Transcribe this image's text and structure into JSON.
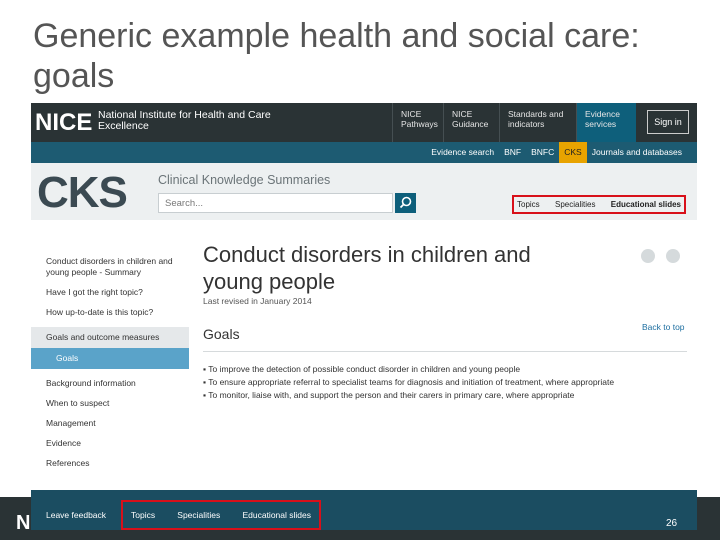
{
  "slide": {
    "title": "Generic example health and social care: goals",
    "page_number": "26",
    "footer_logo": "NICE"
  },
  "topbar": {
    "logo": "NICE",
    "logo_sub": "National Institute for Health and Care Excellence",
    "nav": [
      "NICE Pathways",
      "NICE Guidance",
      "Standards and indicators",
      "Evidence services"
    ],
    "signin": "Sign in"
  },
  "subnav": [
    "Evidence search",
    "BNF",
    "BNFC",
    "CKS",
    "Journals and databases"
  ],
  "cks": {
    "logo": "CKS",
    "title": "Clinical Knowledge Summaries",
    "search_placeholder": "Search...",
    "tabs": [
      "Topics",
      "Specialities",
      "Educational slides"
    ]
  },
  "leftnav": {
    "items": [
      "Conduct disorders in children and young people - Summary",
      "Have I got the right topic?",
      "How up-to-date is this topic?",
      "Goals and outcome measures",
      "Goals",
      "Background information",
      "When to suspect",
      "Management",
      "Evidence",
      "References"
    ]
  },
  "main": {
    "heading": "Conduct disorders in children and young people",
    "revised": "Last revised in January 2014",
    "section": "Goals",
    "back_to_top": "Back to top",
    "goals": [
      "To improve the detection of possible conduct disorder in children and young people",
      "To ensure appropriate referral to specialist teams for diagnosis and initiation of treatment, where appropriate",
      "To monitor, liaise with, and support the person and their carers in primary care, where appropriate"
    ]
  },
  "footer": {
    "leave_feedback": "Leave feedback",
    "links": [
      "Topics",
      "Specialities",
      "Educational slides"
    ]
  },
  "colors": {
    "accent": "#d8101a",
    "nav_dark": "#2a3335",
    "nav_blue": "#1d5b72",
    "ck_highlight": "#e8a300"
  }
}
